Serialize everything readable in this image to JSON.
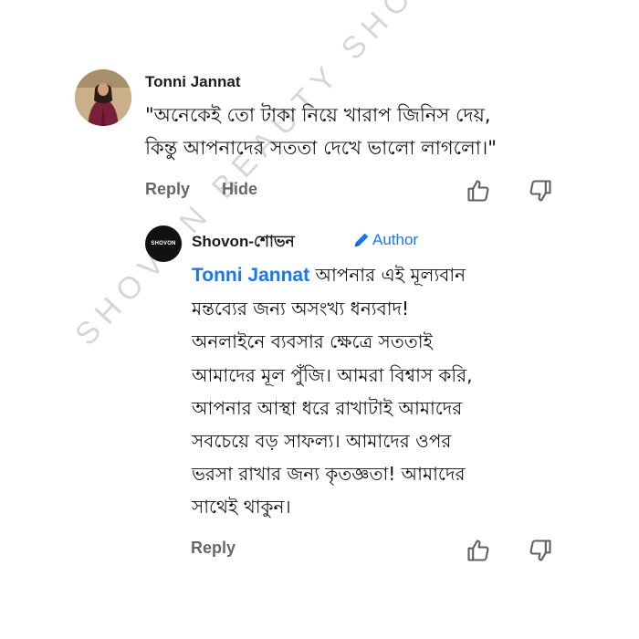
{
  "watermark": "SHOVON BEAUTY SHOP",
  "comment": {
    "author": "Tonni Jannat",
    "text_lines": [
      "\"অনেকেই তো টাকা নিয়ে খারাপ জিনিস দেয়,",
      "কিন্তু আপনাদের সততা দেখে ভালো লাগলো।\""
    ],
    "reply_label": "Reply",
    "hide_label": "Hide"
  },
  "reply": {
    "author": "Shovon-শোভন",
    "avatar_text": "SHOVON",
    "badge_label": "Author",
    "mention": "Tonni Jannat",
    "first_line_rest": " আপনার এই মূল্যবান",
    "text_lines": [
      "মন্তব্যের জন্য অসংখ্য ধন্যবাদ!",
      "অনলাইনে ব্যবসার ক্ষেত্রে সততাই",
      "আমাদের মূল পুঁজি। আমরা বিশ্বাস করি,",
      "আপনার আস্থা ধরে রাখাটাই আমাদের",
      "সবচেয়ে বড় সাফল্য। আমাদের ওপর",
      "ভরসা রাখার জন্য কৃতজ্ঞতা! আমাদের",
      "সাথেই থাকুন।"
    ],
    "reply_label": "Reply"
  },
  "icons": {
    "like": "thumbs-up-icon",
    "dislike": "thumbs-down-icon",
    "author_badge": "pencil-icon"
  },
  "colors": {
    "link_blue": "#1877f2",
    "action_gray": "#65676b"
  }
}
